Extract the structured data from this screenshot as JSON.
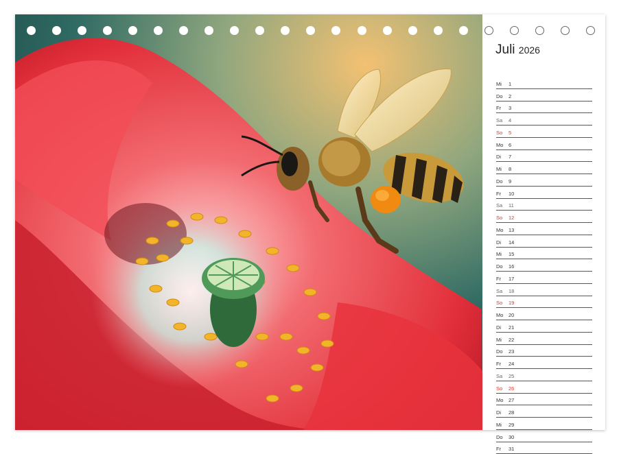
{
  "calendar": {
    "month": "Juli",
    "year": "2026",
    "days": [
      {
        "weekday": "Mi",
        "day": "1",
        "type": "weekday"
      },
      {
        "weekday": "Do",
        "day": "2",
        "type": "weekday"
      },
      {
        "weekday": "Fr",
        "day": "3",
        "type": "weekday"
      },
      {
        "weekday": "Sa",
        "day": "4",
        "type": "saturday"
      },
      {
        "weekday": "So",
        "day": "5",
        "type": "sunday"
      },
      {
        "weekday": "Mo",
        "day": "6",
        "type": "weekday"
      },
      {
        "weekday": "Di",
        "day": "7",
        "type": "weekday"
      },
      {
        "weekday": "Mi",
        "day": "8",
        "type": "weekday"
      },
      {
        "weekday": "Do",
        "day": "9",
        "type": "weekday"
      },
      {
        "weekday": "Fr",
        "day": "10",
        "type": "weekday"
      },
      {
        "weekday": "Sa",
        "day": "11",
        "type": "saturday"
      },
      {
        "weekday": "So",
        "day": "12",
        "type": "sunday"
      },
      {
        "weekday": "Mo",
        "day": "13",
        "type": "weekday"
      },
      {
        "weekday": "Di",
        "day": "14",
        "type": "weekday"
      },
      {
        "weekday": "Mi",
        "day": "15",
        "type": "weekday"
      },
      {
        "weekday": "Do",
        "day": "16",
        "type": "weekday"
      },
      {
        "weekday": "Fr",
        "day": "17",
        "type": "weekday"
      },
      {
        "weekday": "Sa",
        "day": "18",
        "type": "saturday"
      },
      {
        "weekday": "So",
        "day": "19",
        "type": "sunday"
      },
      {
        "weekday": "Mo",
        "day": "20",
        "type": "weekday"
      },
      {
        "weekday": "Di",
        "day": "21",
        "type": "weekday"
      },
      {
        "weekday": "Mi",
        "day": "22",
        "type": "weekday"
      },
      {
        "weekday": "Do",
        "day": "23",
        "type": "weekday"
      },
      {
        "weekday": "Fr",
        "day": "24",
        "type": "weekday"
      },
      {
        "weekday": "Sa",
        "day": "25",
        "type": "saturday"
      },
      {
        "weekday": "So",
        "day": "26",
        "type": "sunday"
      },
      {
        "weekday": "Mo",
        "day": "27",
        "type": "weekday"
      },
      {
        "weekday": "Di",
        "day": "28",
        "type": "weekday"
      },
      {
        "weekday": "Mi",
        "day": "29",
        "type": "weekday"
      },
      {
        "weekday": "Do",
        "day": "30",
        "type": "weekday"
      },
      {
        "weekday": "Fr",
        "day": "31",
        "type": "weekday"
      }
    ]
  },
  "photo": {
    "subject": "bee-on-poppy-illustration",
    "colors": {
      "poppy": "#e8323c",
      "stamen": "#f2b42a",
      "pod": "#4f9a58",
      "bee": "#c99a3a",
      "pollen": "#f08a10",
      "background": "#2f6a63"
    }
  },
  "colors": {
    "sunday": "#d23a2a",
    "saturday": "#666666",
    "text": "#333333",
    "rule": "#555555"
  }
}
